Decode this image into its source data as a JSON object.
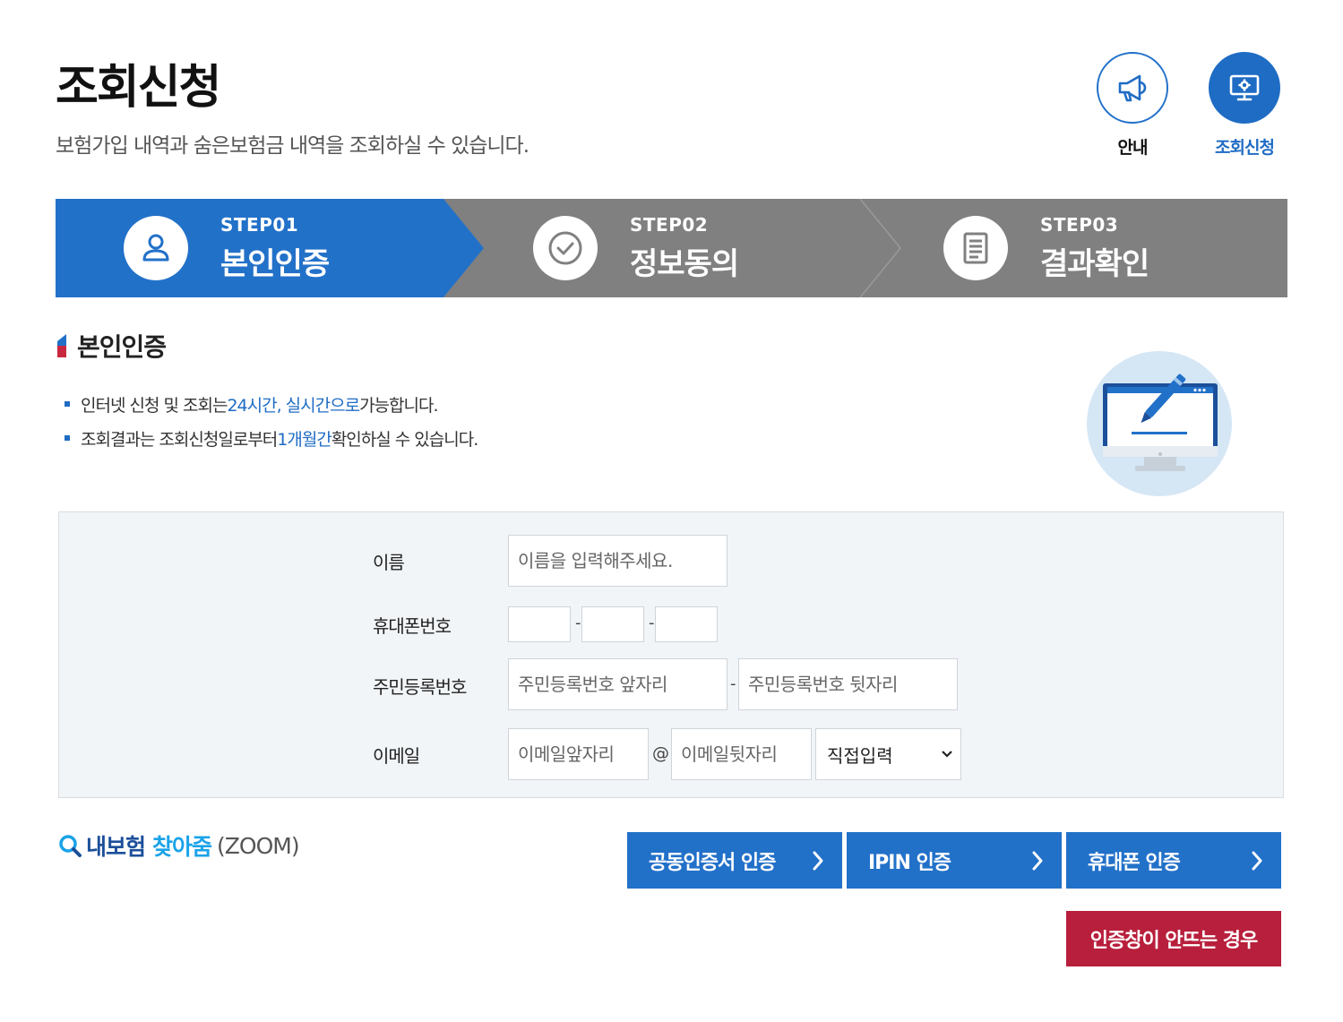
{
  "header": {
    "title": "조회신청",
    "description": "보험가입 내역과 숨은보험금 내역을 조회하실 수 있습니다."
  },
  "top_nav": [
    {
      "label": "안내",
      "icon": "megaphone-icon",
      "active": false
    },
    {
      "label": "조회신청",
      "icon": "monitor-settings-icon",
      "active": true
    }
  ],
  "steps": [
    {
      "number": "STEP01",
      "name": "본인인증",
      "icon": "user-icon",
      "active": true
    },
    {
      "number": "STEP02",
      "name": "정보동의",
      "icon": "check-circle-icon",
      "active": false
    },
    {
      "number": "STEP03",
      "name": "결과확인",
      "icon": "document-icon",
      "active": false
    }
  ],
  "section": {
    "title": "본인인증",
    "bullets": [
      {
        "pre": "인터넷 신청 및 조회는 ",
        "hl": "24시간, 실시간으로",
        "post": " 가능합니다."
      },
      {
        "pre": "조회결과는 조회신청일로부터 ",
        "hl": "1개월간",
        "post": " 확인하실 수 있습니다."
      }
    ]
  },
  "form": {
    "name_label": "이름",
    "name_placeholder": "이름을 입력해주세요.",
    "phone_label": "휴대폰번호",
    "phone_sep": "-",
    "rrn_label": "주민등록번호",
    "rrn_front_placeholder": "주민등록번호 앞자리",
    "rrn_back_placeholder": "주민등록번호 뒷자리",
    "rrn_sep": "-",
    "email_label": "이메일",
    "email_front_placeholder": "이메일앞자리",
    "email_at": "@",
    "email_back_placeholder": "이메일뒷자리",
    "email_domain_selected": "직접입력"
  },
  "zoom_logo": {
    "part1": "내보험",
    "part2": "찾아줌",
    "part3": "(ZOOM)"
  },
  "auth_buttons": [
    {
      "label": "공동인증서 인증"
    },
    {
      "label": "IPIN 인증"
    },
    {
      "label": "휴대폰 인증"
    }
  ],
  "help_button": "인증창이 안뜨는 경우",
  "colors": {
    "primary": "#2271c9",
    "step_inactive": "#808080",
    "warning": "#b81f3c",
    "form_bg": "#f2f5f8"
  }
}
